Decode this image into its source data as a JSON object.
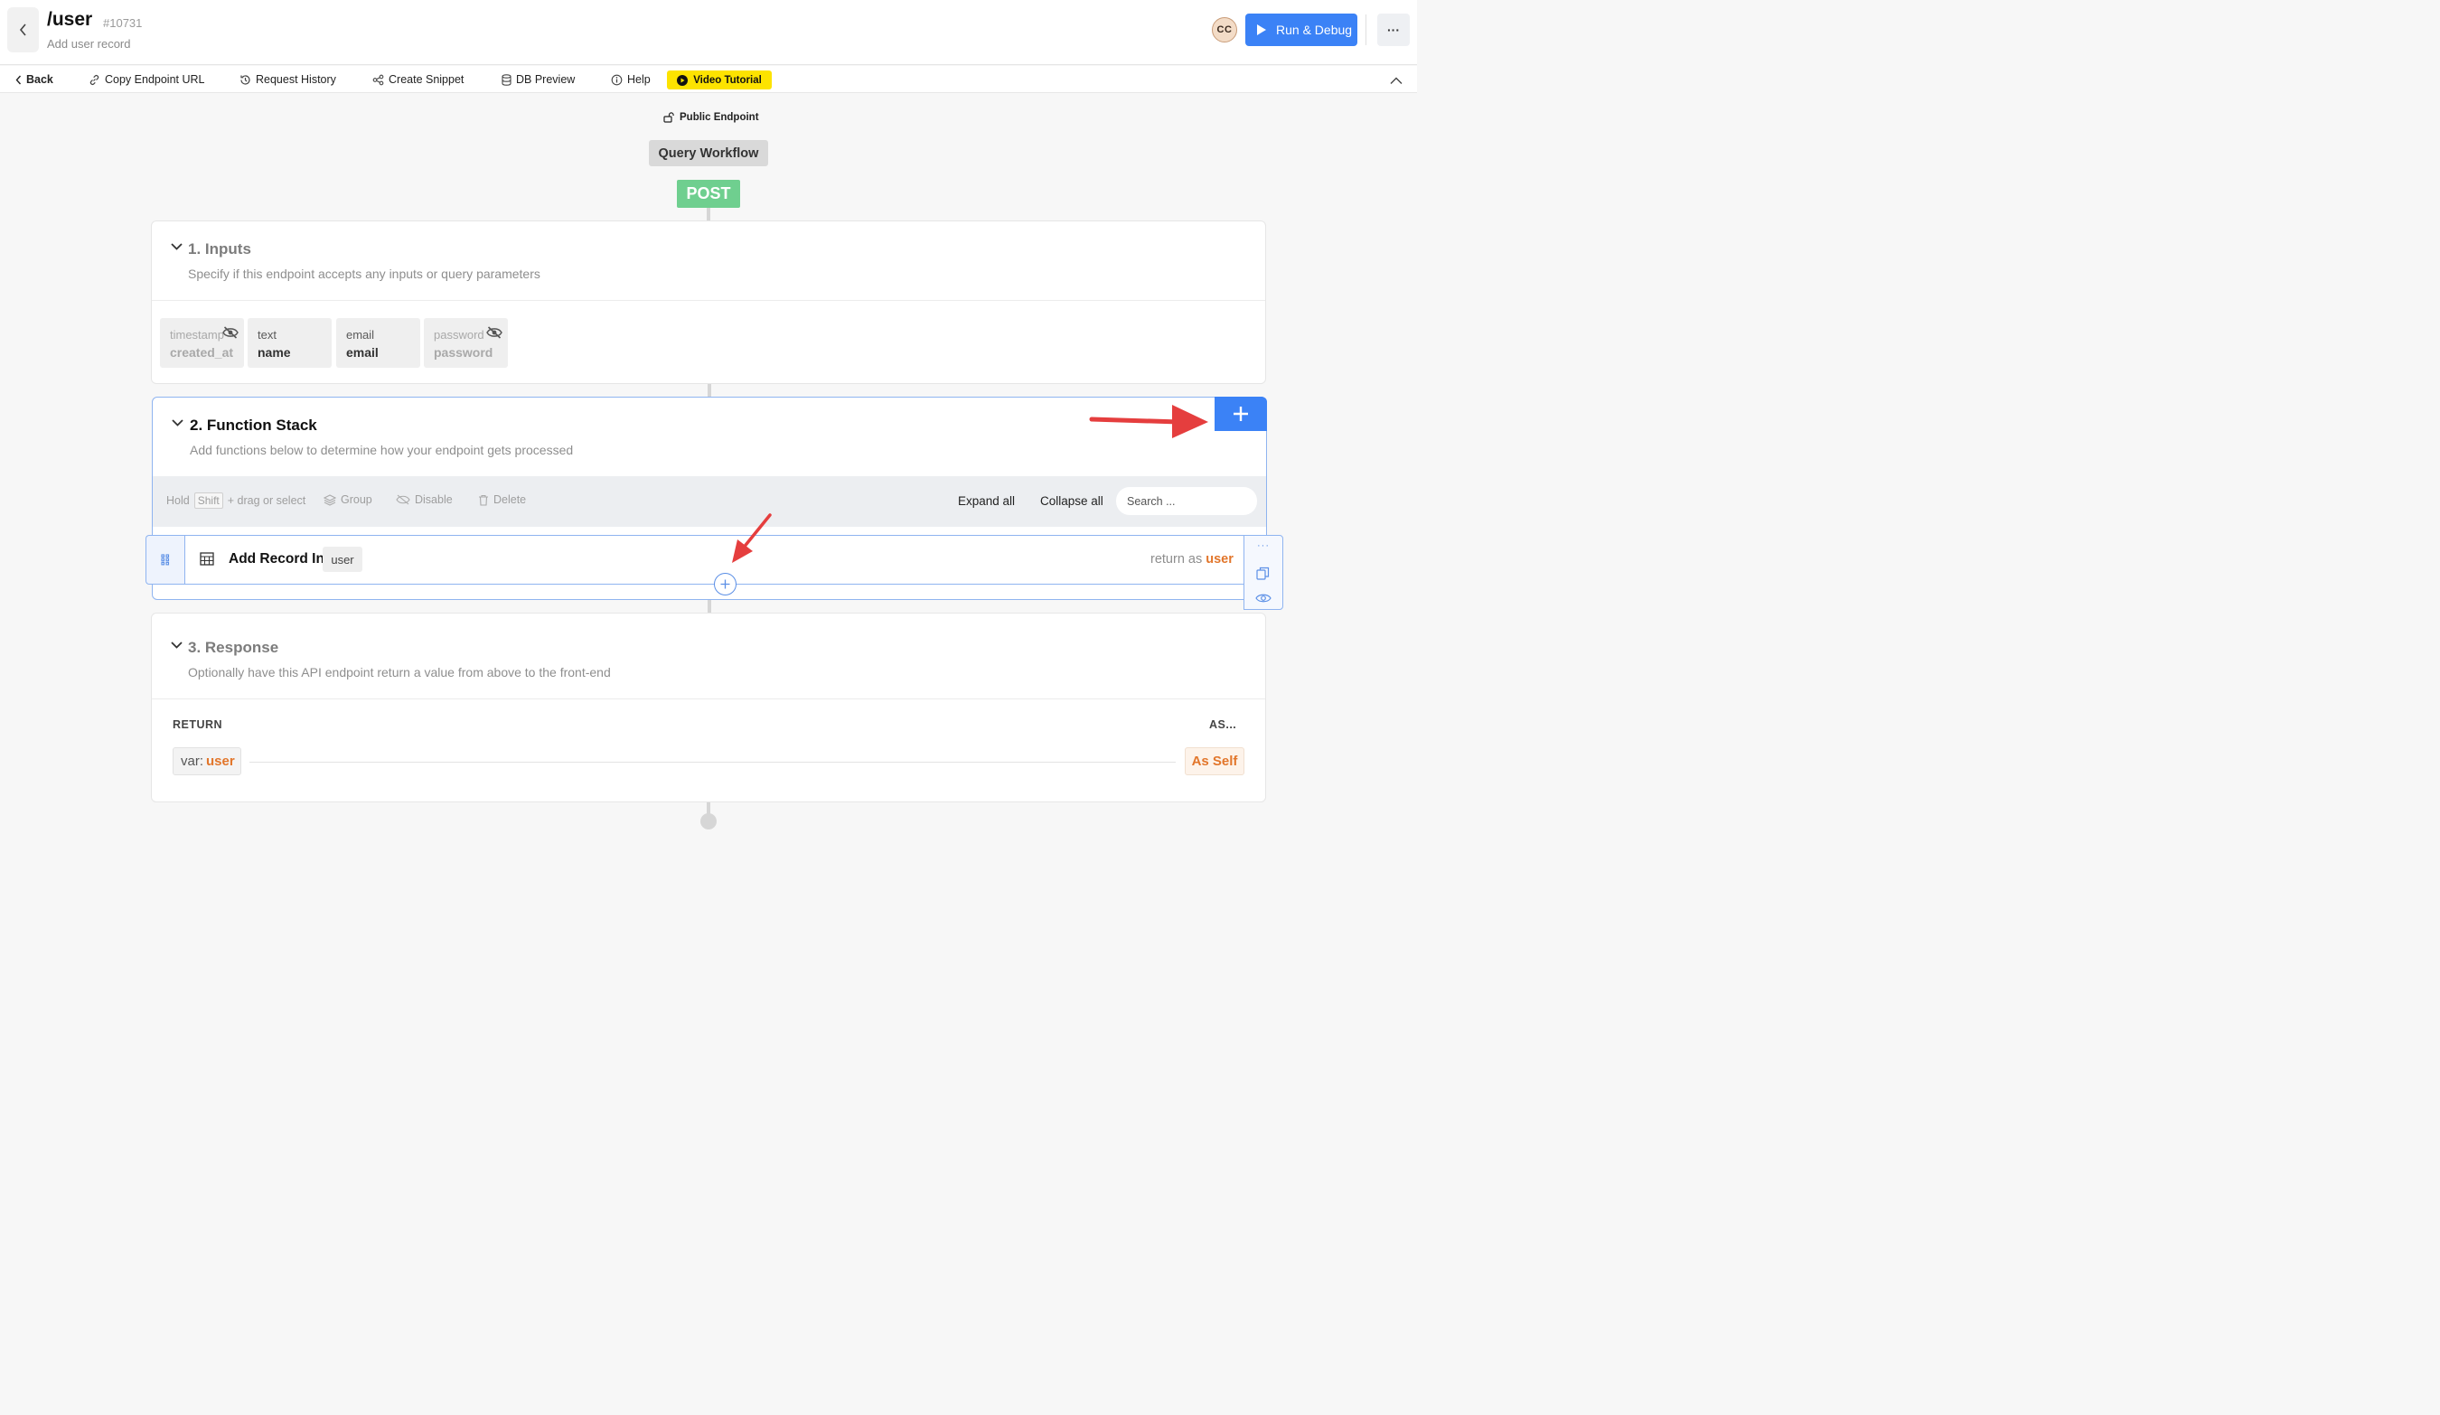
{
  "header": {
    "title": "/user",
    "id": "#10731",
    "subtitle": "Add user record",
    "avatar_initials": "CC",
    "run_label": "Run & Debug",
    "more_label": "···"
  },
  "toolbar": {
    "back": "Back",
    "copy_url": "Copy Endpoint URL",
    "history": "Request History",
    "snippet": "Create Snippet",
    "db_preview": "DB Preview",
    "help": "Help",
    "video": "Video Tutorial"
  },
  "flow": {
    "public_label": "Public Endpoint",
    "workflow_label": "Query Workflow",
    "method": "POST"
  },
  "inputs": {
    "title": "1. Inputs",
    "description": "Specify if this endpoint accepts any inputs or query parameters",
    "items": [
      {
        "type": "timestamp",
        "name": "created_at",
        "hidden": true
      },
      {
        "type": "text",
        "name": "name",
        "hidden": false
      },
      {
        "type": "email",
        "name": "email",
        "hidden": false
      },
      {
        "type": "password",
        "name": "password",
        "hidden": true
      }
    ]
  },
  "function_stack": {
    "title": "2. Function Stack",
    "description": "Add functions below to determine how your endpoint gets processed",
    "hint_hold": "Hold",
    "hint_key": "Shift",
    "hint_rest": "+ drag or select",
    "group": "Group",
    "disable": "Disable",
    "delete": "Delete",
    "expand_all": "Expand all",
    "collapse_all": "Collapse all",
    "search_placeholder": "Search ...",
    "function": {
      "title": "Add Record In",
      "table": "user",
      "return_prefix": "return as",
      "return_var": "user"
    }
  },
  "response": {
    "title": "3. Response",
    "description": "Optionally have this API endpoint return a value from above to the front-end",
    "return_label": "RETURN",
    "as_label": "AS...",
    "var_prefix": "var:",
    "var_name": "user",
    "as_value": "As Self"
  },
  "colors": {
    "accent": "#3b82f6",
    "post": "#6fcf8f",
    "var": "#e2762b",
    "annotation_arrow": "#e53e3e",
    "video_bg": "#fde300"
  }
}
